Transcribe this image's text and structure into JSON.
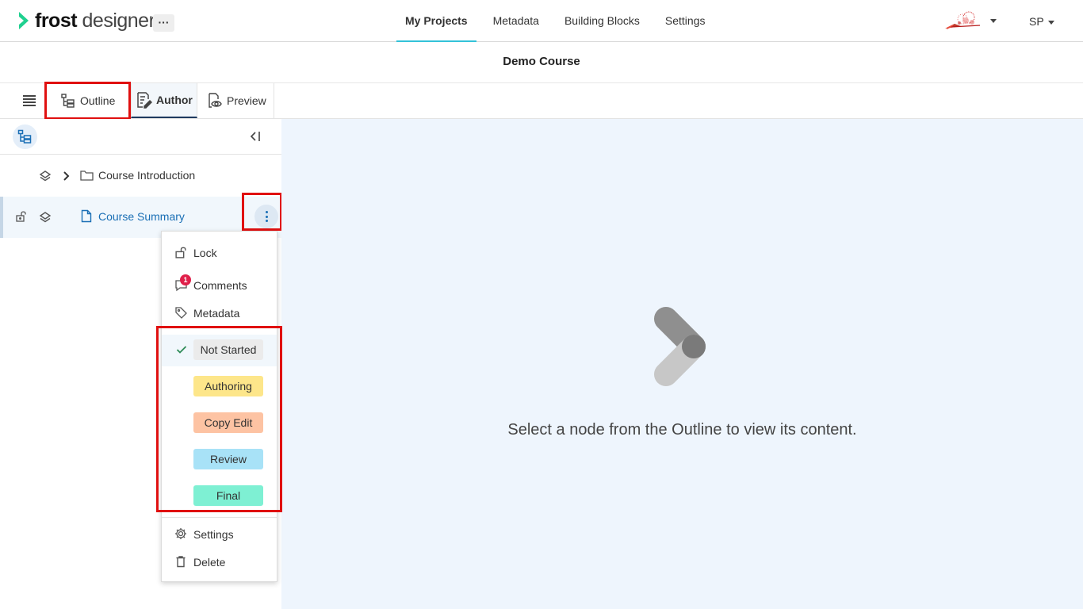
{
  "app": {
    "logo_word1": "frost",
    "logo_word2": "designer",
    "more_label": "···"
  },
  "nav": {
    "items": [
      {
        "label": "My Projects",
        "active": true
      },
      {
        "label": "Metadata",
        "active": false
      },
      {
        "label": "Building Blocks",
        "active": false
      },
      {
        "label": "Settings",
        "active": false
      }
    ],
    "user_initials": "SP"
  },
  "course": {
    "title": "Demo Course"
  },
  "modes": {
    "outline": "Outline",
    "author": "Author",
    "preview": "Preview",
    "active": "Author"
  },
  "tree": {
    "nodes": [
      {
        "label": "Course Introduction",
        "type": "folder",
        "expandable": true
      },
      {
        "label": "Course Summary",
        "type": "page",
        "selected": true
      }
    ]
  },
  "context_menu": {
    "actions": [
      {
        "label": "Lock",
        "icon": "lock-open-icon"
      },
      {
        "label": "Comments",
        "icon": "comment-icon",
        "badge": "1"
      },
      {
        "label": "Metadata",
        "icon": "tag-icon"
      }
    ],
    "statuses": [
      {
        "label": "Not Started",
        "color": "#ebebeb",
        "checked": true
      },
      {
        "label": "Authoring",
        "color": "#fde68a"
      },
      {
        "label": "Copy Edit",
        "color": "#fdc3a3"
      },
      {
        "label": "Review",
        "color": "#a8e2f7"
      },
      {
        "label": "Final",
        "color": "#7ef0d3"
      }
    ],
    "footer": [
      {
        "label": "Settings",
        "icon": "gear-icon"
      },
      {
        "label": "Delete",
        "icon": "trash-icon"
      }
    ]
  },
  "content": {
    "placeholder": "Select a node from the Outline to view its content."
  },
  "colors": {
    "accent": "#33c2d9",
    "link": "#1a6fb5",
    "highlight": "#e01010",
    "content_bg": "#eef5fd"
  }
}
